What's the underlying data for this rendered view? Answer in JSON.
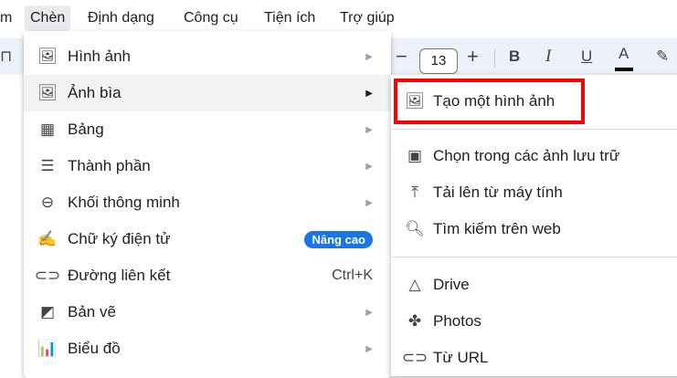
{
  "menubar": {
    "items": [
      "m",
      "Chèn",
      "Định dạng",
      "Công cụ",
      "Tiện ích",
      "Trợ giúp"
    ]
  },
  "toolbar": {
    "minus": "−",
    "font_size": "13",
    "plus": "+",
    "bold": "B",
    "italic": "I",
    "underline": "U",
    "text_color": "A",
    "text_color_value": "#000000"
  },
  "insert_menu": {
    "items": [
      {
        "label": "Hình ảnh",
        "icon": "image-icon"
      },
      {
        "label": "Ảnh bìa",
        "icon": "image-icon"
      },
      {
        "label": "Bảng",
        "icon": "table-icon"
      },
      {
        "label": "Thành phần",
        "icon": "building-blocks-icon"
      },
      {
        "label": "Khối thông minh",
        "icon": "smart-chip-icon"
      },
      {
        "label": "Chữ ký điện tử",
        "icon": "signature-icon",
        "badge": "Nâng cao"
      },
      {
        "label": "Đường liên kết",
        "icon": "link-icon",
        "shortcut": "Ctrl+K"
      },
      {
        "label": "Bản vẽ",
        "icon": "drawing-icon"
      },
      {
        "label": "Biểu đồ",
        "icon": "chart-icon"
      }
    ]
  },
  "cover_submenu": {
    "items": [
      {
        "label": "Tạo một hình ảnh",
        "icon": "generate-image-icon"
      },
      {
        "label": "Chọn trong các ảnh lưu trữ",
        "icon": "stock-images-icon"
      },
      {
        "label": "Tải lên từ máy tính",
        "icon": "upload-icon"
      },
      {
        "label": "Tìm kiếm trên web",
        "icon": "search-icon"
      },
      {
        "label": "Drive",
        "icon": "drive-icon"
      },
      {
        "label": "Photos",
        "icon": "photos-icon"
      },
      {
        "label": "Từ URL",
        "icon": "link-icon"
      }
    ]
  },
  "colors": {
    "badge": "#1a73e8",
    "highlight_box": "#ff0000"
  }
}
